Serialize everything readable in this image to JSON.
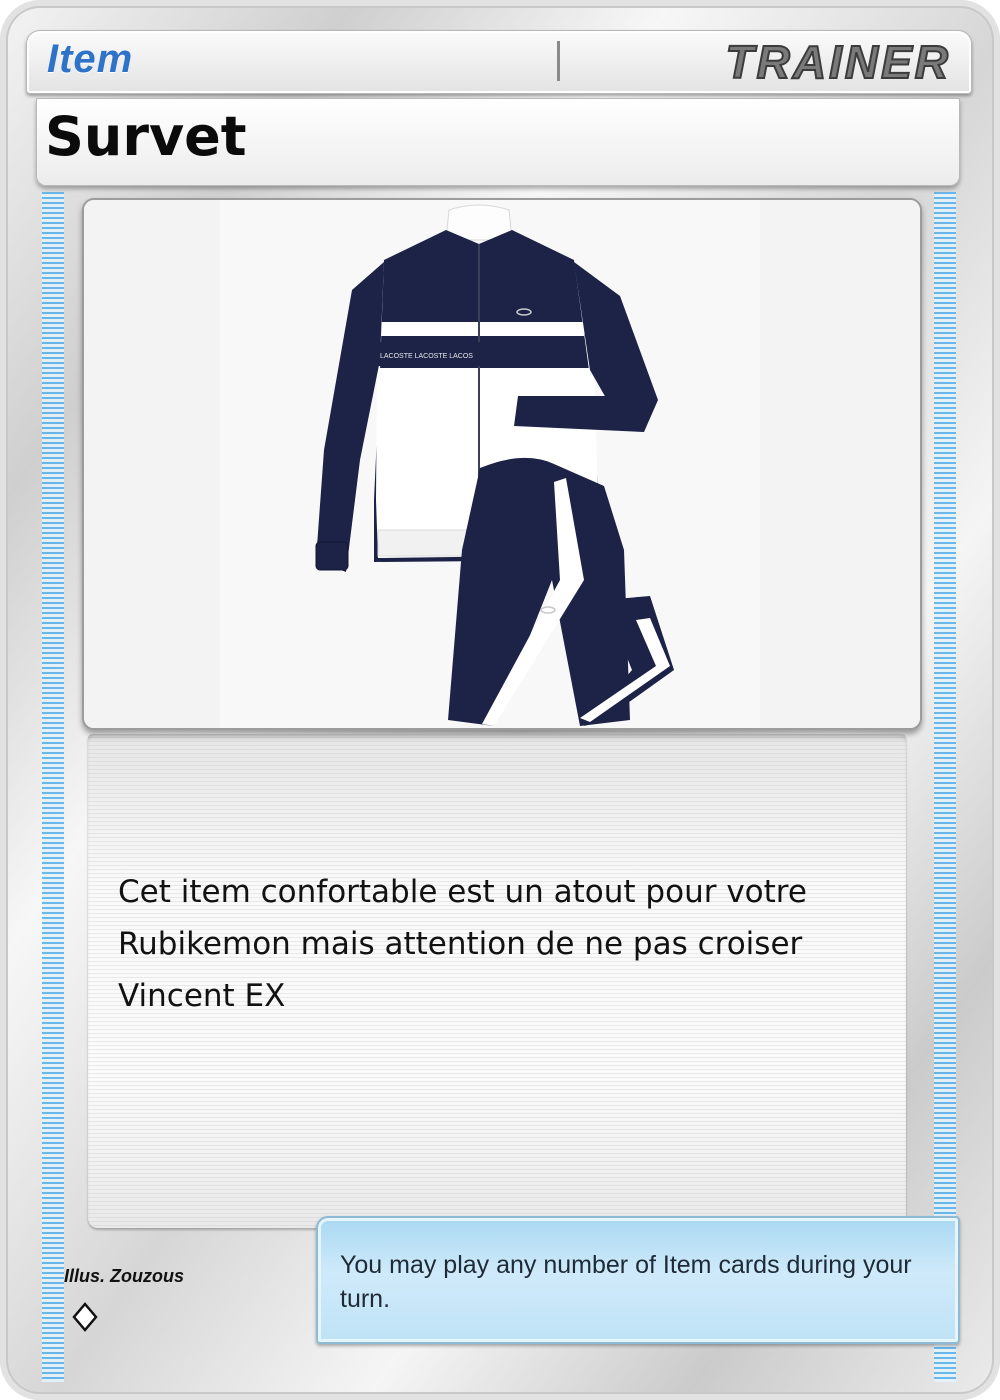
{
  "card": {
    "category": "Item",
    "supertype": "TRAINER",
    "name": "Survet",
    "effect_text": "Cet item confortable est un atout pour votre Rubikemon mais attention de ne pas croiser Vincent EX",
    "rule_text": "You may play any number of Item cards during your turn.",
    "illustrator": "Illus. Zouzous",
    "set_icon": "diamond-rarity-icon",
    "artwork": {
      "subject": "navy-and-white-tracksuit-image",
      "brand_tape_text": "LACOSTE LACOSTE LACOSTE LACOSTE LACOSTE LACOS",
      "brand_tape_text_right": "LACOSTE LACOSTE LACOS"
    }
  },
  "colors": {
    "item_label": "#2f73c9",
    "trainer_label": "#7a7a7a",
    "stripe_blue": "#5fb2ea",
    "rule_box": "#bfe2f6",
    "tracksuit_navy": "#1c2347"
  }
}
